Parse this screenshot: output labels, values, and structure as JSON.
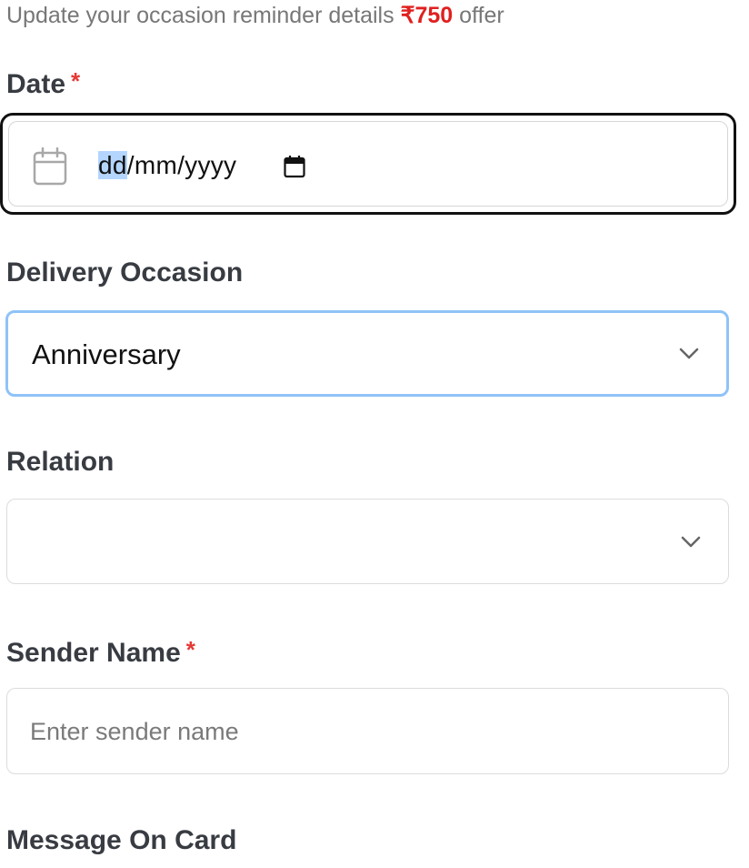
{
  "header": {
    "subtitle_prefix": "Update your occasion reminder details ",
    "offer_amount": "₹750",
    "subtitle_suffix": " offer"
  },
  "date_field": {
    "label": "Date",
    "required_mark": "*",
    "value_day": "dd",
    "value_rest": "/mm/yyyy",
    "left_icon": "calendar-outline-icon",
    "right_icon": "calendar-picker-icon"
  },
  "delivery_occasion": {
    "label": "Delivery Occasion",
    "selected_value": "Anniversary",
    "icon": "chevron-down-icon"
  },
  "relation": {
    "label": "Relation",
    "selected_value": "",
    "icon": "chevron-down-icon"
  },
  "sender_name": {
    "label": "Sender Name",
    "required_mark": "*",
    "placeholder": "Enter sender name"
  },
  "message_on_card": {
    "label": "Message On Card"
  },
  "colors": {
    "accent_red": "#e0201f",
    "focus_blue": "#8fc3f7",
    "text_highlight": "#b4d5fe"
  }
}
